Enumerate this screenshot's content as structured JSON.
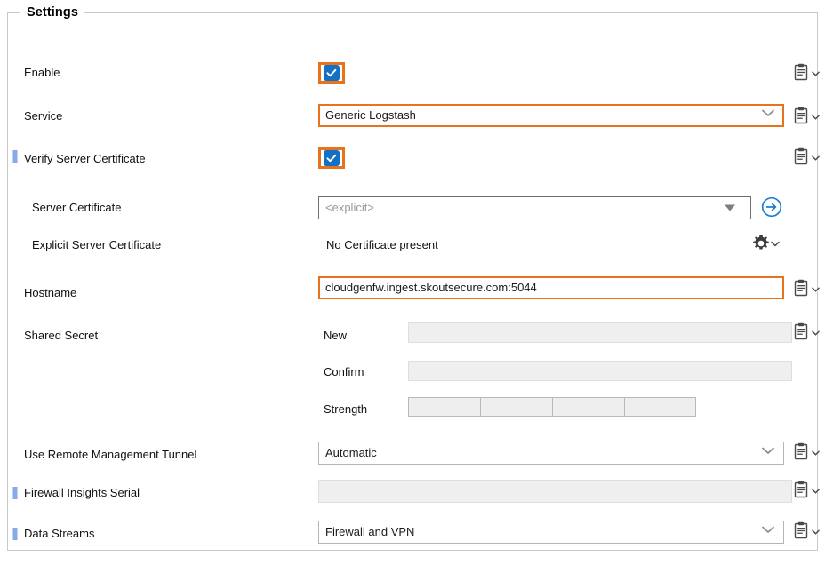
{
  "panel": {
    "title": "Settings"
  },
  "rows": {
    "enable": {
      "label": "Enable",
      "checked": true,
      "copy_icon": "clipboard-icon"
    },
    "service": {
      "label": "Service",
      "value": "Generic Logstash",
      "copy_icon": "clipboard-icon"
    },
    "verify_server_certificate": {
      "label": "Verify Server Certificate",
      "checked": true,
      "copy_icon": "clipboard-icon"
    },
    "server_certificate": {
      "label": "Server Certificate",
      "value": "<explicit>",
      "go_icon": "circle-arrow-right-icon"
    },
    "explicit_server_certificate": {
      "label": "Explicit Server Certificate",
      "value": "No Certificate present",
      "gear_icon": "gear-icon"
    },
    "hostname": {
      "label": "Hostname",
      "value": "cloudgenfw.ingest.skoutsecure.com:5044",
      "copy_icon": "clipboard-icon"
    },
    "shared_secret": {
      "label": "Shared Secret",
      "new_label": "New",
      "new_value": "",
      "confirm_label": "Confirm",
      "confirm_value": "",
      "strength_label": "Strength",
      "strength_segments": 4,
      "strength_filled": 0,
      "copy_icon": "clipboard-icon"
    },
    "remote_tunnel": {
      "label": "Use Remote Management Tunnel",
      "value": "Automatic",
      "copy_icon": "clipboard-icon"
    },
    "firewall_insights_serial": {
      "label": "Firewall Insights Serial",
      "value": "",
      "copy_icon": "clipboard-icon"
    },
    "data_streams": {
      "label": "Data Streams",
      "value": "Firewall and VPN",
      "copy_icon": "clipboard-icon"
    }
  },
  "colors": {
    "highlight": "#e8731a",
    "checkbox": "#1470c4",
    "marker": "#8aa9e8",
    "accent_blue": "#1b7fd4"
  }
}
